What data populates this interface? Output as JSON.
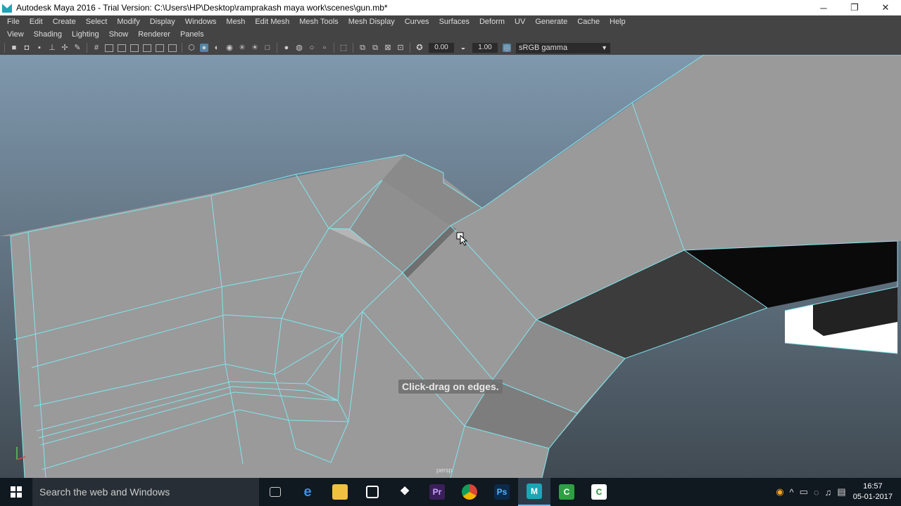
{
  "window": {
    "title": "Autodesk Maya 2016 - Trial Version: C:\\Users\\HP\\Desktop\\ramprakash maya work\\scenes\\gun.mb*",
    "minimize": "─",
    "restore": "❐",
    "close": "✕"
  },
  "menu": [
    "File",
    "Edit",
    "Create",
    "Select",
    "Modify",
    "Display",
    "Windows",
    "Mesh",
    "Edit Mesh",
    "Mesh Tools",
    "Mesh Display",
    "Curves",
    "Surfaces",
    "Deform",
    "UV",
    "Generate",
    "Cache",
    "Help"
  ],
  "panel_menu": [
    "View",
    "Shading",
    "Lighting",
    "Show",
    "Renderer",
    "Panels"
  ],
  "toolbar": {
    "exposure": "0.00",
    "gamma_value": "1.00",
    "color_space": "sRGB gamma"
  },
  "viewport": {
    "hud_message": "Click-drag on edges.",
    "camera": "persp"
  },
  "taskbar": {
    "search_placeholder": "Search the web and Windows",
    "time": "16:57",
    "date": "05-01-2017"
  },
  "colors": {
    "wire": "#7fe6ee",
    "face": "#9a9a9a",
    "viewport_top": "#7f98ad",
    "taskbar": "#101820"
  }
}
